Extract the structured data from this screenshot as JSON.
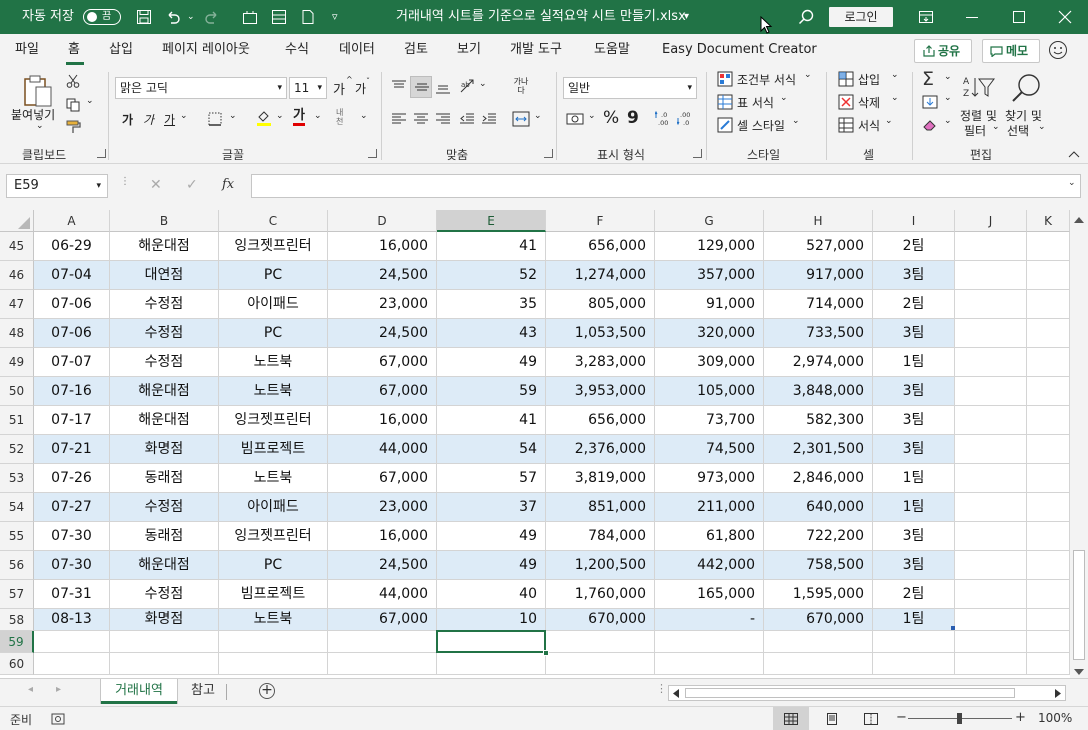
{
  "titlebar": {
    "autosave_label": "자동 저장",
    "autosave_state": "끔",
    "file_title": "거래내역 시트를 기준으로 실적요약 시트 만들기.xlsx",
    "title_dropdown": "⌄",
    "login_label": "로그인",
    "accent_color": "#217346"
  },
  "menu": {
    "tabs": [
      "파일",
      "홈",
      "삽입",
      "페이지 레이아웃",
      "수식",
      "데이터",
      "검토",
      "보기",
      "개발 도구",
      "도움말",
      "Easy Document Creator"
    ],
    "active_tab": "홈",
    "share_label": "공유",
    "memo_label": "메모"
  },
  "ribbon": {
    "clipboard": {
      "paste_label": "붙여넣기",
      "group_label": "클립보드"
    },
    "font": {
      "font_name": "맑은 고딕",
      "font_size": "11",
      "grow": "가",
      "shrink": "가",
      "bold": "가",
      "italic": "가",
      "underline": "가",
      "font_color_glyph": "가",
      "phonetic": "내천",
      "group_label": "글꼴"
    },
    "alignment": {
      "wrap": "가나다",
      "group_label": "맞춤"
    },
    "number": {
      "format": "일반",
      "percent": "%",
      "comma": "9",
      "group_label": "표시 형식"
    },
    "styles": {
      "conditional": "조건부 서식",
      "table": "표 서식",
      "cell_style": "셀 스타일",
      "group_label": "스타일"
    },
    "cells": {
      "insert": "삽입",
      "delete": "삭제",
      "format": "서식",
      "group_label": "셀"
    },
    "editing": {
      "sigma": "Σ",
      "sort_filter_1": "정렬 및",
      "sort_filter_2": "필터",
      "find_select_1": "찾기 및",
      "find_select_2": "선택",
      "group_label": "편집"
    }
  },
  "formula_bar": {
    "name_box": "E59",
    "cancel": "✕",
    "enter": "✓",
    "fx": "fx",
    "formula": ""
  },
  "columns": [
    "A",
    "B",
    "C",
    "D",
    "E",
    "F",
    "G",
    "H",
    "I",
    "J",
    "K"
  ],
  "selected_column": "E",
  "selected_row": "59",
  "rows": [
    {
      "num": "45",
      "cells": [
        "06-29",
        "해운대점",
        "잉크젯프린터",
        "16,000",
        "41",
        "656,000",
        "129,000",
        "527,000",
        "2팀"
      ]
    },
    {
      "num": "46",
      "cells": [
        "07-04",
        "대연점",
        "PC",
        "24,500",
        "52",
        "1,274,000",
        "357,000",
        "917,000",
        "3팀"
      ]
    },
    {
      "num": "47",
      "cells": [
        "07-06",
        "수정점",
        "아이패드",
        "23,000",
        "35",
        "805,000",
        "91,000",
        "714,000",
        "2팀"
      ]
    },
    {
      "num": "48",
      "cells": [
        "07-06",
        "수정점",
        "PC",
        "24,500",
        "43",
        "1,053,500",
        "320,000",
        "733,500",
        "3팀"
      ]
    },
    {
      "num": "49",
      "cells": [
        "07-07",
        "수정점",
        "노트북",
        "67,000",
        "49",
        "3,283,000",
        "309,000",
        "2,974,000",
        "1팀"
      ]
    },
    {
      "num": "50",
      "cells": [
        "07-16",
        "해운대점",
        "노트북",
        "67,000",
        "59",
        "3,953,000",
        "105,000",
        "3,848,000",
        "3팀"
      ]
    },
    {
      "num": "51",
      "cells": [
        "07-17",
        "해운대점",
        "잉크젯프린터",
        "16,000",
        "41",
        "656,000",
        "73,700",
        "582,300",
        "3팀"
      ]
    },
    {
      "num": "52",
      "cells": [
        "07-21",
        "화명점",
        "빔프로젝트",
        "44,000",
        "54",
        "2,376,000",
        "74,500",
        "2,301,500",
        "3팀"
      ]
    },
    {
      "num": "53",
      "cells": [
        "07-26",
        "동래점",
        "노트북",
        "67,000",
        "57",
        "3,819,000",
        "973,000",
        "2,846,000",
        "1팀"
      ]
    },
    {
      "num": "54",
      "cells": [
        "07-27",
        "수정점",
        "아이패드",
        "23,000",
        "37",
        "851,000",
        "211,000",
        "640,000",
        "1팀"
      ]
    },
    {
      "num": "55",
      "cells": [
        "07-30",
        "동래점",
        "잉크젯프린터",
        "16,000",
        "49",
        "784,000",
        "61,800",
        "722,200",
        "3팀"
      ]
    },
    {
      "num": "56",
      "cells": [
        "07-30",
        "해운대점",
        "PC",
        "24,500",
        "49",
        "1,200,500",
        "442,000",
        "758,500",
        "3팀"
      ]
    },
    {
      "num": "57",
      "cells": [
        "07-31",
        "수정점",
        "빔프로젝트",
        "44,000",
        "40",
        "1,760,000",
        "165,000",
        "1,595,000",
        "2팀"
      ]
    },
    {
      "num": "58",
      "cells": [
        "08-13",
        "화명점",
        "노트북",
        "67,000",
        "10",
        "670,000",
        "-",
        "670,000",
        "1팀"
      ]
    },
    {
      "num": "59",
      "cells": [
        "",
        "",
        "",
        "",
        "",
        "",
        "",
        "",
        ""
      ]
    },
    {
      "num": "60",
      "cells": [
        "",
        "",
        "",
        "",
        "",
        "",
        "",
        "",
        ""
      ]
    }
  ],
  "band_color": "#ddebf7",
  "sheets": [
    "거래내역",
    "참고"
  ],
  "active_sheet": "거래내역",
  "add_sheet": "+",
  "status": {
    "ready": "준비",
    "zoom": "100%",
    "zoom_minus": "−",
    "zoom_plus": "+"
  }
}
